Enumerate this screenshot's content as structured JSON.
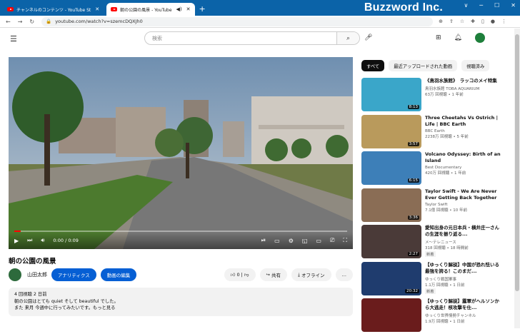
{
  "browser": {
    "tabs": [
      {
        "label": "チャンネルのコンテンツ - YouTube St"
      },
      {
        "label": "朝の公園の風景 - YouTube"
      }
    ],
    "new_tab": "+",
    "brand": "Buzzword Inc.",
    "url": "youtube.com/watch?v=szemcDQXJh0",
    "window_controls": [
      "∨",
      "─",
      "☐",
      "✕"
    ]
  },
  "youtube": {
    "search_placeholder": "検索"
  },
  "player": {
    "time": "0:00 / 0:09",
    "progress": 0.02
  },
  "video": {
    "title": "朝の公園の風景",
    "channel": "山田太郎",
    "analytics_label": "アナリティクス",
    "edit_label": "動画の編集",
    "likes": "0",
    "share_label": "共有",
    "offline_label": "オフライン",
    "more": "…",
    "desc_meta": "4 回視聴  2 日前",
    "desc_line1": "朝の公園はとても quiet そして beautiful でした。",
    "desc_line2": "また 来月 今週中に行ってみたいです。もっと見る"
  },
  "filters": [
    "すべて",
    "最近アップロードされた動画",
    "視聴済み"
  ],
  "recommendations": [
    {
      "title": "《鳥羽水族館》　ラッコのメイ特集",
      "channel": "鳥羽水族館 TOBA AQUARIUM",
      "meta": "63万 回視聴 • 1 年前",
      "duration": "8:13",
      "color": "#3aa6c9",
      "badge": ""
    },
    {
      "title": "Three Cheetahs Vs Ostrich | Life | BBC Earth",
      "channel": "BBC Earth",
      "meta": "2238万 回視聴 • 5 年前",
      "duration": "3:57",
      "color": "#b99a5c",
      "badge": ""
    },
    {
      "title": "Volcano Odyssey: Birth of an Island",
      "channel": "Best Documentary",
      "meta": "420万 回視聴 • 1 年前",
      "duration": "6:15",
      "color": "#3d7fb8",
      "badge": ""
    },
    {
      "title": "Taylor Swift - We Are Never Ever Getting Back Together",
      "channel": "Taylor Swift",
      "meta": "7.1億 回視聴 • 10 年前",
      "duration": "3:36",
      "color": "#8a6d55",
      "badge": ""
    },
    {
      "title": "愛知出身の元日本兵・横井庄一さんの生涯を振り返る...",
      "channel": "メ～テレニュース",
      "meta": "318 回視聴 • 18 時間前",
      "duration": "2:27",
      "color": "#4a3a38",
      "badge": "新着"
    },
    {
      "title": "【ゆっくり解説】中国が恐れ怯いる最強を誇る！このまだ...",
      "channel": "ゆっくり戦国軍事",
      "meta": "1.1万 回視聴 • 1 日前",
      "duration": "20:32",
      "color": "#1f3c6e",
      "badge": "新着"
    },
    {
      "title": "【ゆっくり解説】露軍がヘルソンから大逃走！核攻撃を仕...",
      "channel": "ゆっくり世界情勢チャンネル",
      "meta": "1.9万 回視聴 • 1 日前",
      "duration": "",
      "color": "#6a1c1c",
      "badge": ""
    }
  ]
}
